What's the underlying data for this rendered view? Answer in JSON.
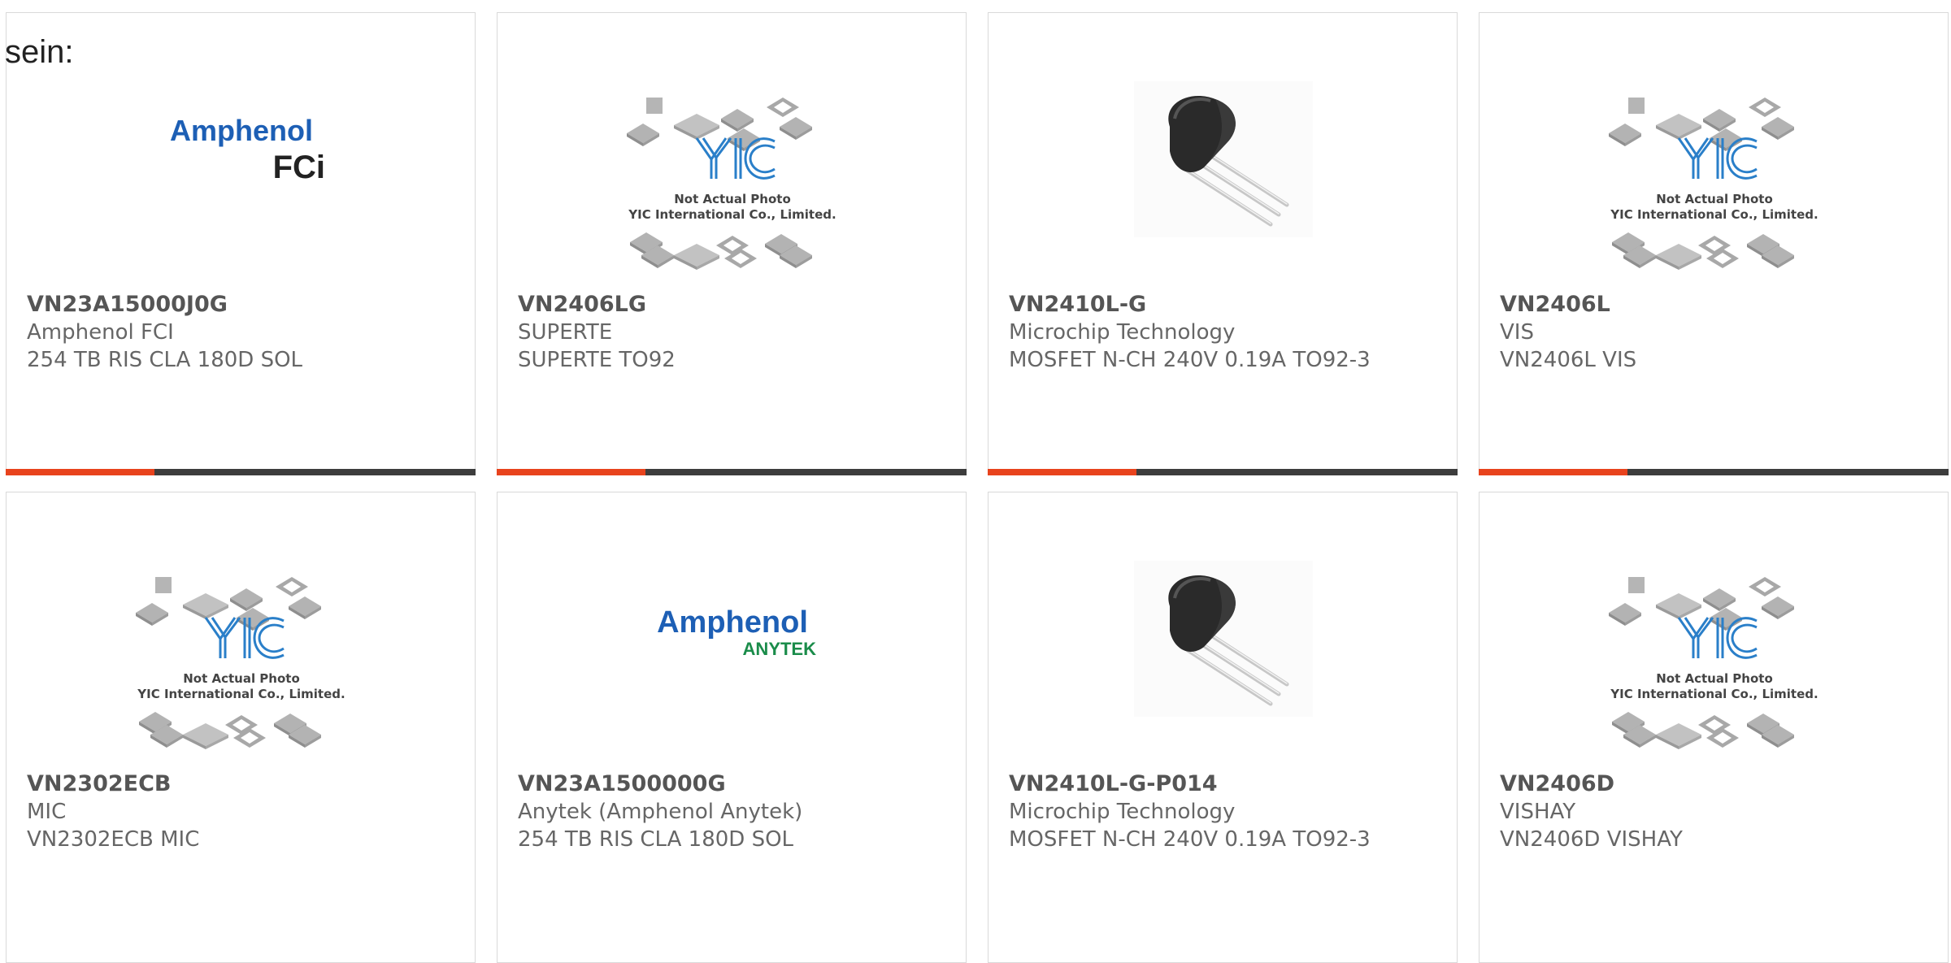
{
  "lead_text": "sein:",
  "colors": {
    "accent": "#e8431d",
    "bar_dark": "#3d3d3d",
    "yic_blue": "#2a7fc9",
    "anytek_green": "#1a8c4a",
    "amphenol_blue": "#1d5fb5"
  },
  "placeholder": {
    "line1": "Not Actual Photo",
    "line2": "YIC International Co., Limited.",
    "logo": "YIC"
  },
  "logos": {
    "amphenol_fci": {
      "brand": "Amphenol",
      "sub": "FCi"
    },
    "amphenol_anytek": {
      "brand": "Amphenol",
      "sub": "ANYTEK"
    }
  },
  "products": [
    {
      "part": "VN23A15000J0G",
      "maker": "Amphenol FCI",
      "desc": "254 TB RIS CLA 180D SOL",
      "image": "amphenol-fci-logo"
    },
    {
      "part": "VN2406LG",
      "maker": "SUPERTE",
      "desc": "SUPERTE TO92",
      "image": "placeholder"
    },
    {
      "part": "VN2410L-G",
      "maker": "Microchip Technology",
      "desc": "MOSFET N-CH 240V 0.19A TO92-3",
      "image": "to92-transistor"
    },
    {
      "part": "VN2406L",
      "maker": "VIS",
      "desc": "VN2406L VIS",
      "image": "placeholder"
    },
    {
      "part": "VN2302ECB",
      "maker": "MIC",
      "desc": "VN2302ECB MIC",
      "image": "placeholder"
    },
    {
      "part": "VN23A1500000G",
      "maker": "Anytek (Amphenol Anytek)",
      "desc": "254 TB RIS CLA 180D SOL",
      "image": "amphenol-anytek-logo"
    },
    {
      "part": "VN2410L-G-P014",
      "maker": "Microchip Technology",
      "desc": "MOSFET N-CH 240V 0.19A TO92-3",
      "image": "to92-transistor"
    },
    {
      "part": "VN2406D",
      "maker": "VISHAY",
      "desc": "VN2406D VISHAY",
      "image": "placeholder"
    }
  ]
}
